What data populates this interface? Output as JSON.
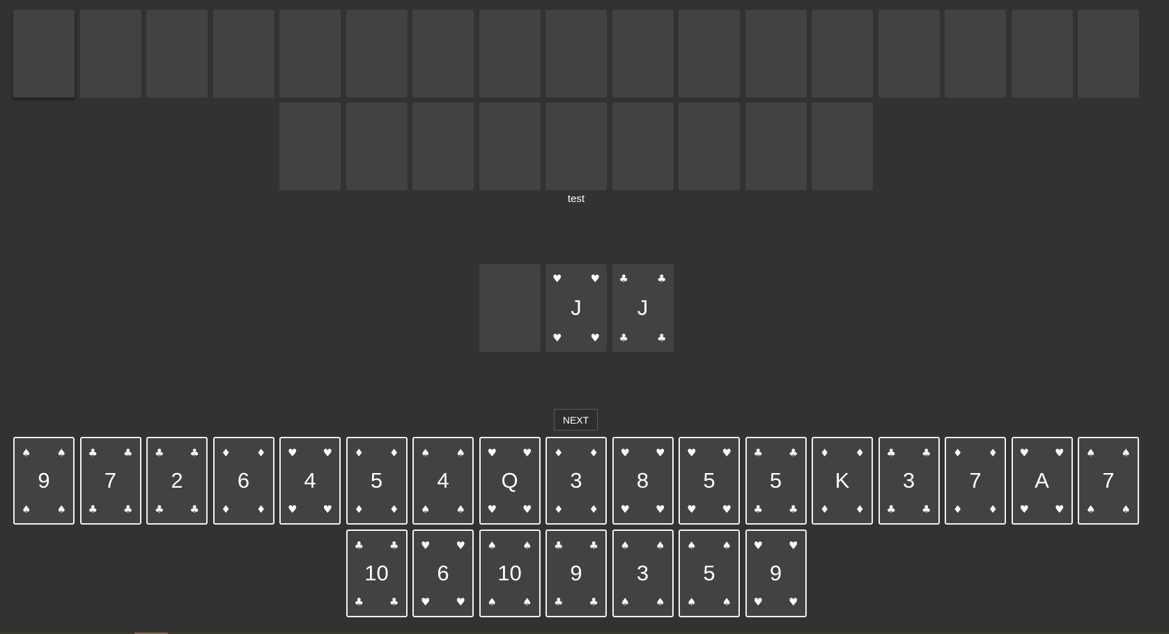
{
  "opponent": {
    "row1_count": 17,
    "row2_count": 9
  },
  "status_text": "test",
  "table": {
    "pile_empty": true,
    "cards": [
      {
        "rank": "J",
        "suit": "♥"
      },
      {
        "rank": "J",
        "suit": "♣"
      }
    ]
  },
  "next_button_label": "NEXT",
  "hand": {
    "row1": [
      {
        "rank": "9",
        "suit": "♠"
      },
      {
        "rank": "7",
        "suit": "♣"
      },
      {
        "rank": "2",
        "suit": "♣"
      },
      {
        "rank": "6",
        "suit": "♦"
      },
      {
        "rank": "4",
        "suit": "♥"
      },
      {
        "rank": "5",
        "suit": "♦"
      },
      {
        "rank": "4",
        "suit": "♠"
      },
      {
        "rank": "Q",
        "suit": "♥"
      },
      {
        "rank": "3",
        "suit": "♦"
      },
      {
        "rank": "8",
        "suit": "♥"
      },
      {
        "rank": "5",
        "suit": "♥"
      },
      {
        "rank": "5",
        "suit": "♣"
      },
      {
        "rank": "K",
        "suit": "♦"
      },
      {
        "rank": "3",
        "suit": "♣"
      },
      {
        "rank": "7",
        "suit": "♦"
      },
      {
        "rank": "A",
        "suit": "♥"
      },
      {
        "rank": "7",
        "suit": "♠"
      }
    ],
    "row2": [
      {
        "rank": "10",
        "suit": "♣"
      },
      {
        "rank": "6",
        "suit": "♥"
      },
      {
        "rank": "10",
        "suit": "♠"
      },
      {
        "rank": "9",
        "suit": "♣"
      },
      {
        "rank": "3",
        "suit": "♠"
      },
      {
        "rank": "5",
        "suit": "♠"
      },
      {
        "rank": "9",
        "suit": "♥"
      }
    ]
  },
  "colors": {
    "background": "#323232",
    "card_fill": "#424242",
    "card_border": "#f2f2f2"
  }
}
